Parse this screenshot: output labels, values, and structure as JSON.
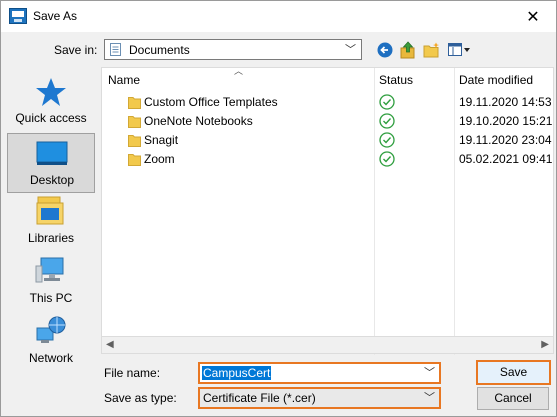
{
  "window": {
    "title": "Save As",
    "close_glyph": "✕"
  },
  "save_in": {
    "label": "Save in:",
    "value": "Documents"
  },
  "places": [
    {
      "label": "Quick access",
      "icon": "star-icon",
      "selected": false
    },
    {
      "label": "Desktop",
      "icon": "desktop-icon",
      "selected": true
    },
    {
      "label": "Libraries",
      "icon": "libraries-icon",
      "selected": false
    },
    {
      "label": "This PC",
      "icon": "computer-icon",
      "selected": false
    },
    {
      "label": "Network",
      "icon": "network-icon",
      "selected": false
    }
  ],
  "columns": {
    "name": "Name",
    "status": "Status",
    "date": "Date modified"
  },
  "files": [
    {
      "name": "Custom Office Templates",
      "date": "19.11.2020 14:53"
    },
    {
      "name": "OneNote Notebooks",
      "date": "19.10.2020 15:21"
    },
    {
      "name": "Snagit",
      "date": "19.11.2020 23:04"
    },
    {
      "name": "Zoom",
      "date": "05.02.2021 09:41"
    }
  ],
  "file_name": {
    "label": "File name:",
    "value": "CampusCert"
  },
  "save_as_type": {
    "label": "Save as type:",
    "value": "Certificate File (*.cer)"
  },
  "buttons": {
    "save": "Save",
    "cancel": "Cancel"
  },
  "colors": {
    "highlight": "#e87722",
    "selection": "#0078d7",
    "status_ok": "#2e9e3e"
  }
}
